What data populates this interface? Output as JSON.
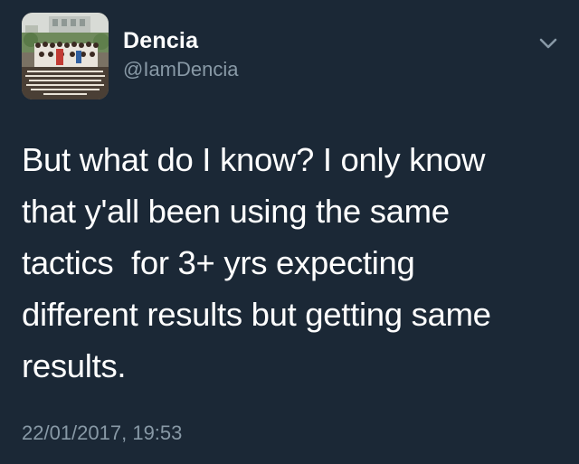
{
  "tweet": {
    "author": {
      "display_name": "Dencia",
      "handle": "@IamDencia",
      "avatar_icon": "group-photo-avatar"
    },
    "menu_icon": "chevron-down-icon",
    "text": "But what do I know? I only know\nthat y'all been using the same\ntactics  for 3+ yrs expecting\ndifferent results but getting same\nresults.",
    "timestamp": "22/01/2017, 19:53"
  },
  "colors": {
    "background": "#1b2836",
    "primary_text": "#ffffff",
    "secondary_text": "#8899a6"
  }
}
